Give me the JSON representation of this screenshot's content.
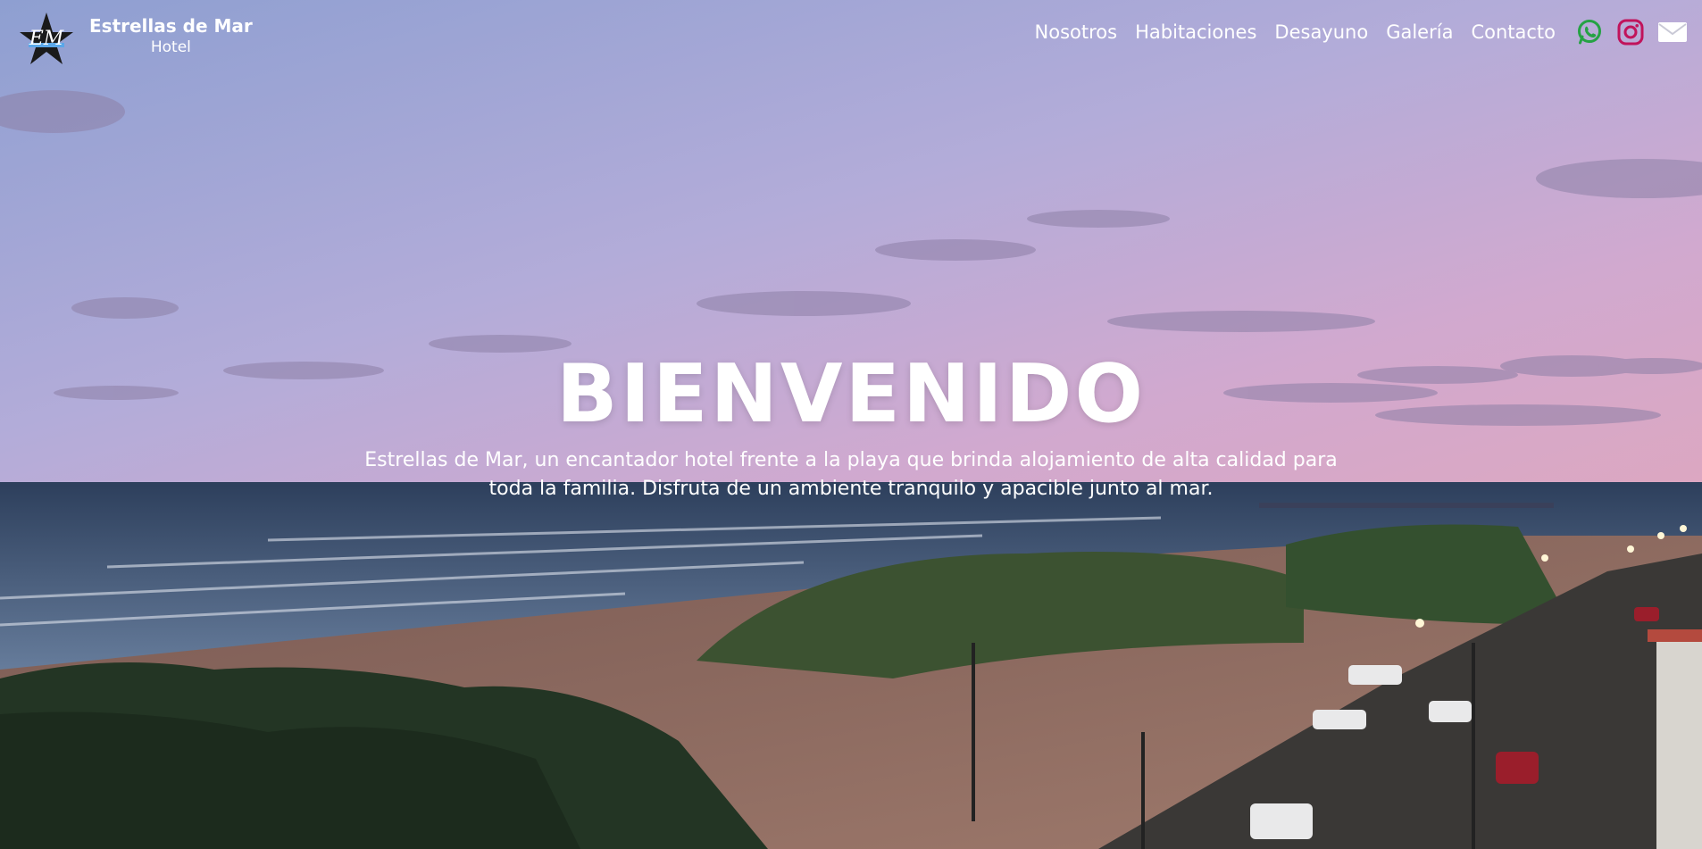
{
  "brand": {
    "name": "Estrellas de Mar",
    "subtitle": "Hotel",
    "logo_icon": "star-logo-icon",
    "logo_text": "EM"
  },
  "nav": {
    "items": [
      {
        "label": "Nosotros"
      },
      {
        "label": "Habitaciones"
      },
      {
        "label": "Desayuno"
      },
      {
        "label": "Galería"
      },
      {
        "label": "Contacto"
      }
    ],
    "icons": [
      {
        "name": "whatsapp-icon",
        "color": "#25a244"
      },
      {
        "name": "instagram-icon",
        "color": "#c1135b"
      },
      {
        "name": "mail-icon",
        "color": "#ffffff"
      }
    ]
  },
  "hero": {
    "title": "BIENVENIDO",
    "description": "Estrellas de Mar, un encantador hotel frente a la playa que brinda alojamiento de alta calidad para toda la familia. Disfruta de un ambiente tranquilo y apacible junto al mar."
  }
}
